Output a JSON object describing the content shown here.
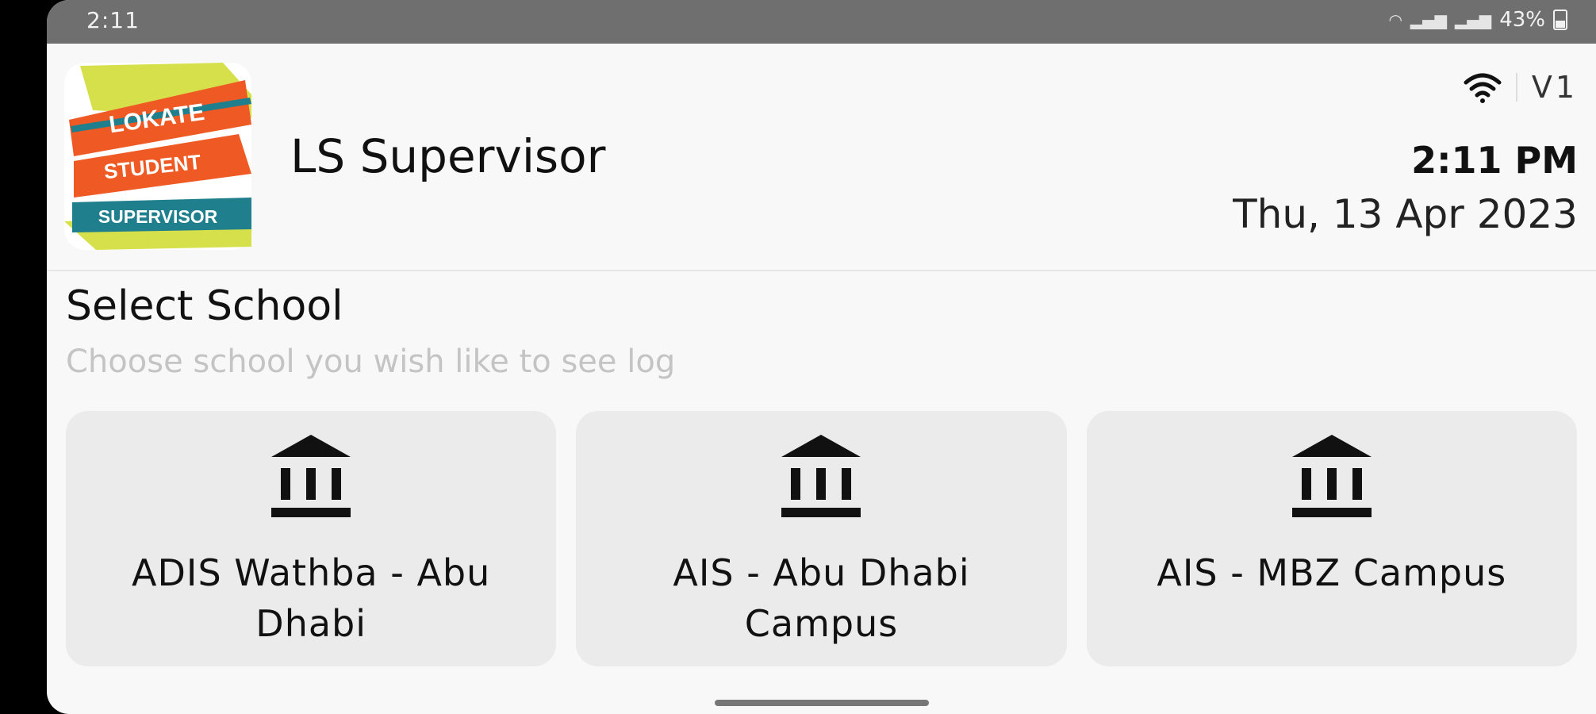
{
  "status_bar": {
    "time": "2:11",
    "battery": "43%"
  },
  "header": {
    "logo": {
      "line1": "LOKATE",
      "line2": "STUDENT",
      "line3": "SUPERVISOR"
    },
    "app_title": "LS Supervisor",
    "version": "V1",
    "time": "2:11 PM",
    "date": "Thu, 13 Apr 2023"
  },
  "select_school": {
    "title": "Select School",
    "subtitle": "Choose school you wish like to see log",
    "schools": [
      {
        "name": "ADIS Wathba - Abu Dhabi"
      },
      {
        "name": "AIS - Abu Dhabi Campus"
      },
      {
        "name": "AIS - MBZ Campus"
      }
    ]
  },
  "colors": {
    "logo_orange": "#ef5a24",
    "logo_teal": "#1f7f8c",
    "logo_lime": "#d6e04a"
  },
  "icons": [
    "wifi-icon",
    "signal-icon",
    "battery-icon",
    "bank-icon"
  ]
}
